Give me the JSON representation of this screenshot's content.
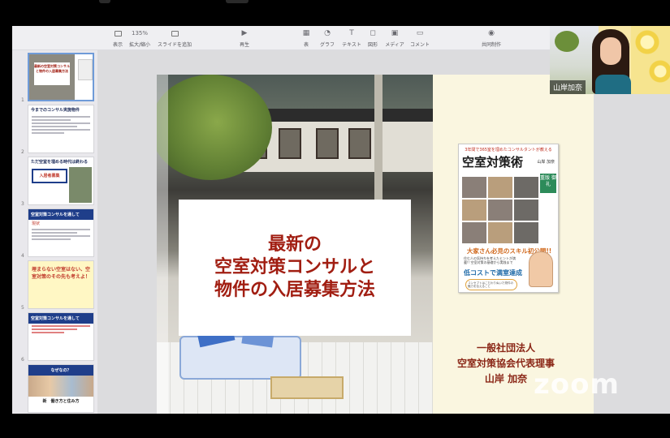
{
  "toolbar": {
    "zoom": "135%",
    "items": [
      {
        "label": "表示",
        "icon": "sidebar-icon"
      },
      {
        "label": "拡大/縮小",
        "icon": "zoom-icon"
      },
      {
        "label": "スライドを追加",
        "icon": "add-slide-icon"
      },
      {
        "label": "再生",
        "icon": "play-icon"
      },
      {
        "label": "表",
        "icon": "table-icon"
      },
      {
        "label": "グラフ",
        "icon": "chart-icon"
      },
      {
        "label": "テキスト",
        "icon": "text-icon"
      },
      {
        "label": "図形",
        "icon": "shape-icon"
      },
      {
        "label": "メディア",
        "icon": "media-icon"
      },
      {
        "label": "コメント",
        "icon": "comment-icon"
      },
      {
        "label": "共同制作",
        "icon": "collaborate-icon"
      }
    ]
  },
  "sidebar": {
    "slides": [
      {
        "num": "1",
        "title": "最新の空室対策コンサルと物件の入居募集方法"
      },
      {
        "num": "2",
        "title": "今までのコンサル実施物件"
      },
      {
        "num": "3",
        "title": "ただ空室を埋める時代は終わる",
        "tag": "入居者募集"
      },
      {
        "num": "4",
        "title": "空室対策コンサルを通して",
        "sub": "現状"
      },
      {
        "num": "5",
        "title": "埋まらない空室はない、空室対策のその先も考えよ！"
      },
      {
        "num": "6",
        "title": "空室対策コンサルを通して"
      },
      {
        "num": "",
        "title": "なぜなの？",
        "sub": "新　働き方と住み方"
      }
    ]
  },
  "slide": {
    "title_lines": [
      "最新の",
      "空室対策コンサルと",
      "物件の入居募集方法"
    ],
    "book": {
      "subtitle": "3年間で365室を埋めたコンサルタントが教える",
      "title": "空室対策術",
      "author": "山岸 加奈",
      "stamp": "重版 御礼",
      "headline": "大家さん必見のスキル初公開!!",
      "body": "住む人の気持ちを考えたヒントが満載!! 空室対策の基礎から実践まで",
      "highlight": "低コストで満室達成",
      "bubble": "コンセプトはこだわりぬいた物件の魅力を伝えること"
    },
    "organization_lines": [
      "一般社団法人",
      "空室対策協会代表理事",
      "山岸 加奈"
    ]
  },
  "video": {
    "participant_name": "山岸加奈"
  },
  "zoom_logo": "zoom",
  "colors": {
    "title_red": "#a11e12",
    "org_red": "#8a2616",
    "slide_bg": "#faf6e0"
  }
}
